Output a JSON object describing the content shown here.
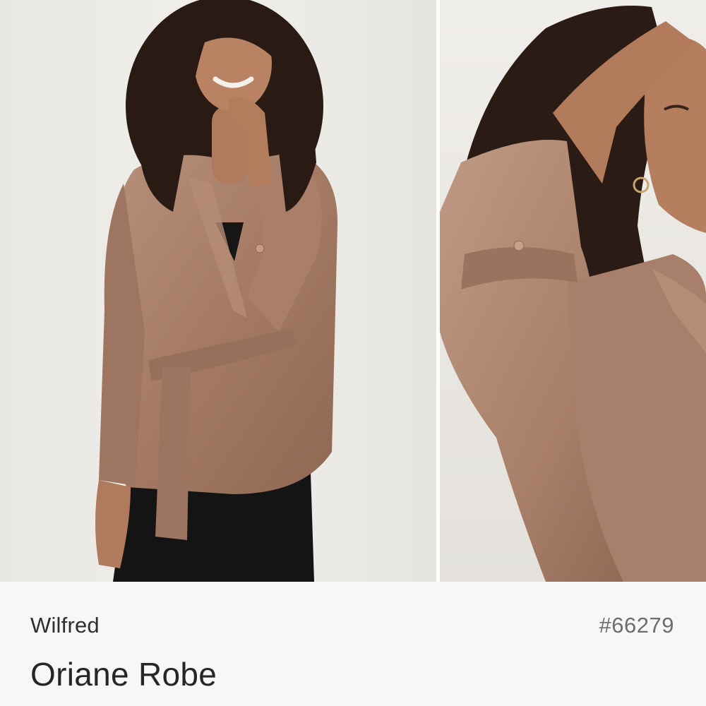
{
  "product": {
    "brand": "Wilfred",
    "name": "Oriane Robe",
    "sku": "#66279"
  },
  "colors": {
    "garment": "#a57c67",
    "hair": "#2a1a14",
    "skin": "#b07a5c",
    "pants": "#141414",
    "background": "#f7f7f7"
  },
  "images": [
    {
      "name": "main-photo",
      "alt": ""
    },
    {
      "name": "detail-photo",
      "alt": ""
    }
  ]
}
